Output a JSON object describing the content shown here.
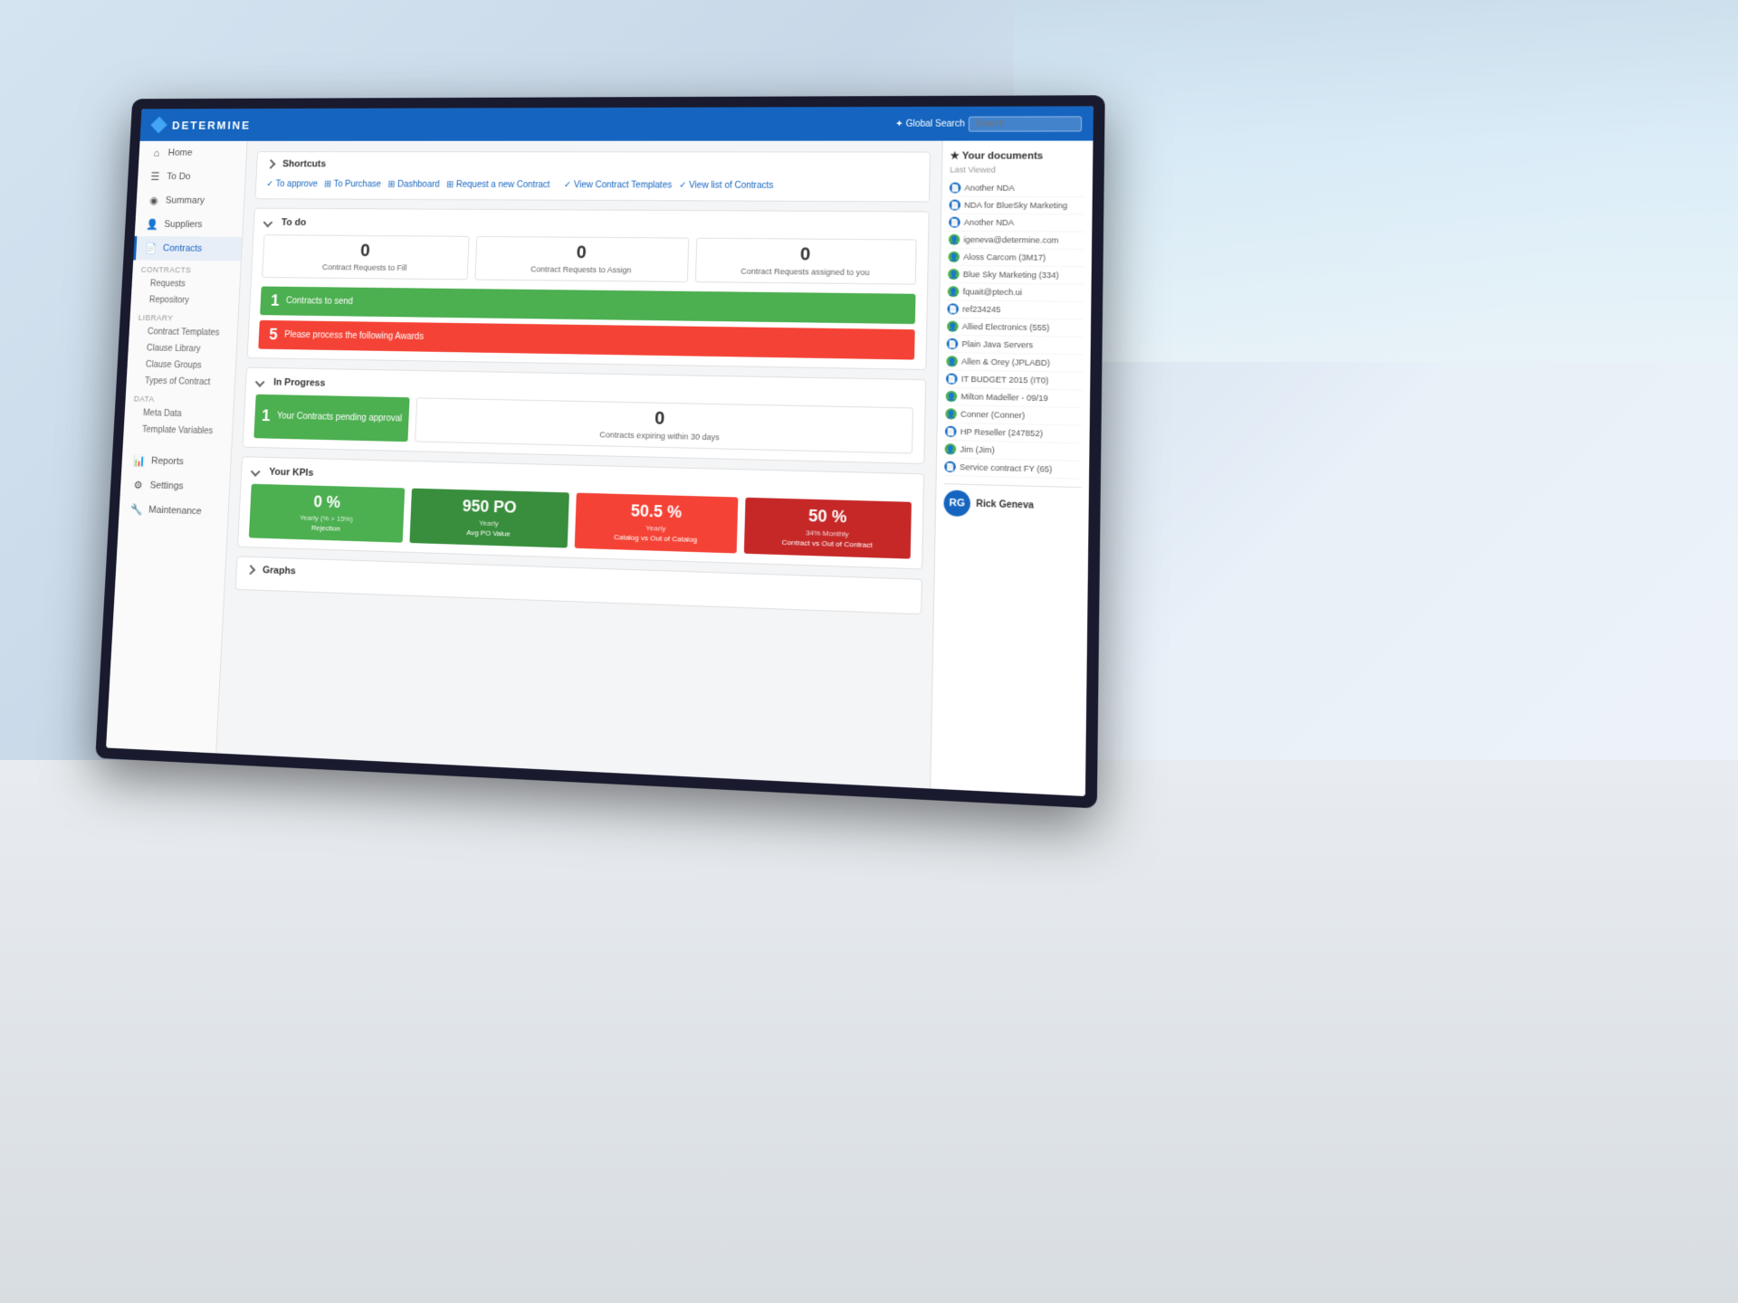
{
  "app": {
    "name": "DETERMINE",
    "logo_icon": "◆"
  },
  "topbar": {
    "search_label": "✦ Global Search",
    "search_placeholder": "Search"
  },
  "sidebar": {
    "items": [
      {
        "id": "home",
        "label": "Home",
        "icon": "⌂"
      },
      {
        "id": "todo",
        "label": "To Do",
        "icon": "☰"
      },
      {
        "id": "summary",
        "label": "Summary",
        "icon": "◉"
      },
      {
        "id": "suppliers",
        "label": "Suppliers",
        "icon": "👤"
      },
      {
        "id": "contracts",
        "label": "Contracts",
        "icon": "📄",
        "active": true
      }
    ],
    "contracts_section": "CONTRACTS",
    "contracts_sub": [
      "Requests",
      "Repository"
    ],
    "library_section": "LIBRARY",
    "library_sub": [
      "Contract Templates",
      "Clause Library",
      "Clause Groups",
      "Types of Contract"
    ],
    "data_section": "DATA",
    "data_sub": [
      "Meta Data",
      "Template Variables"
    ],
    "bottom_items": [
      {
        "id": "reports",
        "label": "Reports",
        "icon": "📊"
      },
      {
        "id": "settings",
        "label": "Settings",
        "icon": "⚙"
      },
      {
        "id": "maintenance",
        "label": "Maintenance",
        "icon": "🔧"
      }
    ]
  },
  "shortcuts": {
    "title": "Shortcuts",
    "links": [
      {
        "label": "✓ To approve"
      },
      {
        "label": "⊞ To Purchase"
      },
      {
        "label": "⊞ Dashboard"
      },
      {
        "label": "⊞ Request a new Contract"
      },
      {
        "label": "✓ View Contract Templates"
      },
      {
        "label": "✓ View list of Contracts"
      }
    ]
  },
  "todo": {
    "title": "To do",
    "counters": [
      {
        "value": "0",
        "label": "Contract Requests to Fill"
      },
      {
        "value": "0",
        "label": "Contract Requests to Assign"
      },
      {
        "value": "0",
        "label": "Contract Requests assigned to you"
      }
    ],
    "actions": [
      {
        "number": "1",
        "label": "Contracts to send",
        "color": "green"
      },
      {
        "number": "5",
        "label": "Please process the following Awards",
        "color": "red"
      }
    ]
  },
  "inprogress": {
    "title": "In Progress",
    "items": [
      {
        "number": "1",
        "label": "Your Contracts pending approval",
        "color": "green"
      },
      {
        "number": "0",
        "label": "Contracts expiring within 30 days",
        "color": "neutral"
      }
    ]
  },
  "kpis": {
    "title": "Your KPIs",
    "cards": [
      {
        "value": "0 %",
        "sublabel": "Yearly (% > 15%)",
        "label": "Rejection",
        "color": "green"
      },
      {
        "value": "950 PO",
        "sublabel": "Yearly",
        "label": "Avg PO Value",
        "color": "dark-green"
      },
      {
        "value": "50.5 %",
        "sublabel": "Yearly",
        "label": "Catalog vs Out of Catalog",
        "color": "red"
      },
      {
        "value": "50 %",
        "sublabel": "34% Monthly",
        "label": "Contract vs Out of Contract",
        "color": "dark-red"
      }
    ]
  },
  "graphs": {
    "title": "Graphs"
  },
  "right_panel": {
    "title": "★ Your documents",
    "last_viewed": "Last Viewed",
    "documents": [
      {
        "label": "Another NDA",
        "icon_type": "blue"
      },
      {
        "label": "NDA for BlueSky Marketing",
        "icon_type": "blue"
      },
      {
        "label": "Another NDA",
        "icon_type": "blue"
      },
      {
        "label": "igeneva@determine.com",
        "icon_type": "green"
      },
      {
        "label": "Aloss Carcom (3M17)",
        "icon_type": "green"
      },
      {
        "label": "Blue Sky Marketing (334)",
        "icon_type": "green"
      },
      {
        "label": "fquait@ptech.ui",
        "icon_type": "green"
      },
      {
        "label": "ref234245",
        "icon_type": "blue"
      },
      {
        "label": "Allied Electronics (555)",
        "icon_type": "green"
      },
      {
        "label": "Plain Java Servers",
        "icon_type": "blue"
      },
      {
        "label": "Allen & Orey (JPLABD)",
        "icon_type": "green"
      },
      {
        "label": "IT BUDGET 2015 (IT0)",
        "icon_type": "blue"
      },
      {
        "label": "Milton Madeller - 09/19",
        "icon_type": "green"
      },
      {
        "label": "Conner (Conner)",
        "icon_type": "green"
      },
      {
        "label": "HP Reseller (247852)",
        "icon_type": "blue"
      },
      {
        "label": "Jim (Jim)",
        "icon_type": "green"
      },
      {
        "label": "Service contract FY (65)",
        "icon_type": "blue"
      }
    ],
    "user": {
      "name": "Rick Geneva",
      "initials": "RG"
    }
  }
}
